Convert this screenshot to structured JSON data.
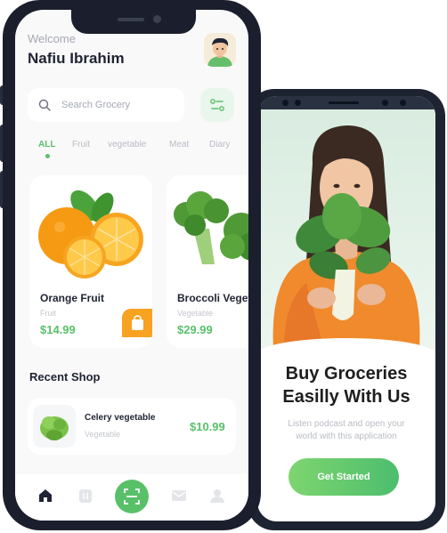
{
  "home": {
    "welcome": "Welcome",
    "user_name": "Nafiu Ibrahim",
    "search_placeholder": "Search  Grocery",
    "categories": [
      "ALL",
      "Fruit",
      "vegetable",
      "Meat",
      "Diary"
    ],
    "active_category": "ALL",
    "products": [
      {
        "name": "Orange Fruit",
        "type": "Fruit",
        "price": "$14.99"
      },
      {
        "name": "Broccoli Vegetable",
        "type": "Vegetable",
        "price": "$29.99"
      }
    ],
    "recent_title": "Recent Shop",
    "recent": [
      {
        "name": "Celery vegetable",
        "type": "Vegetable",
        "price": "$10.99"
      }
    ],
    "nav": [
      "home-icon",
      "receipt-icon",
      "scan-icon",
      "mail-icon",
      "profile-icon"
    ]
  },
  "onboarding": {
    "title_line1": "Buy Groceries",
    "title_line2": "Easilly With Us",
    "desc_line1": "Listen podcast and open your",
    "desc_line2": "world with this application",
    "cta": "Get Started"
  },
  "colors": {
    "accent": "#59c06a",
    "accent_orange": "#f7a221",
    "phone_frame": "#1b1f2d",
    "text_dark": "#1f2333",
    "text_muted": "#a5a9b2"
  }
}
